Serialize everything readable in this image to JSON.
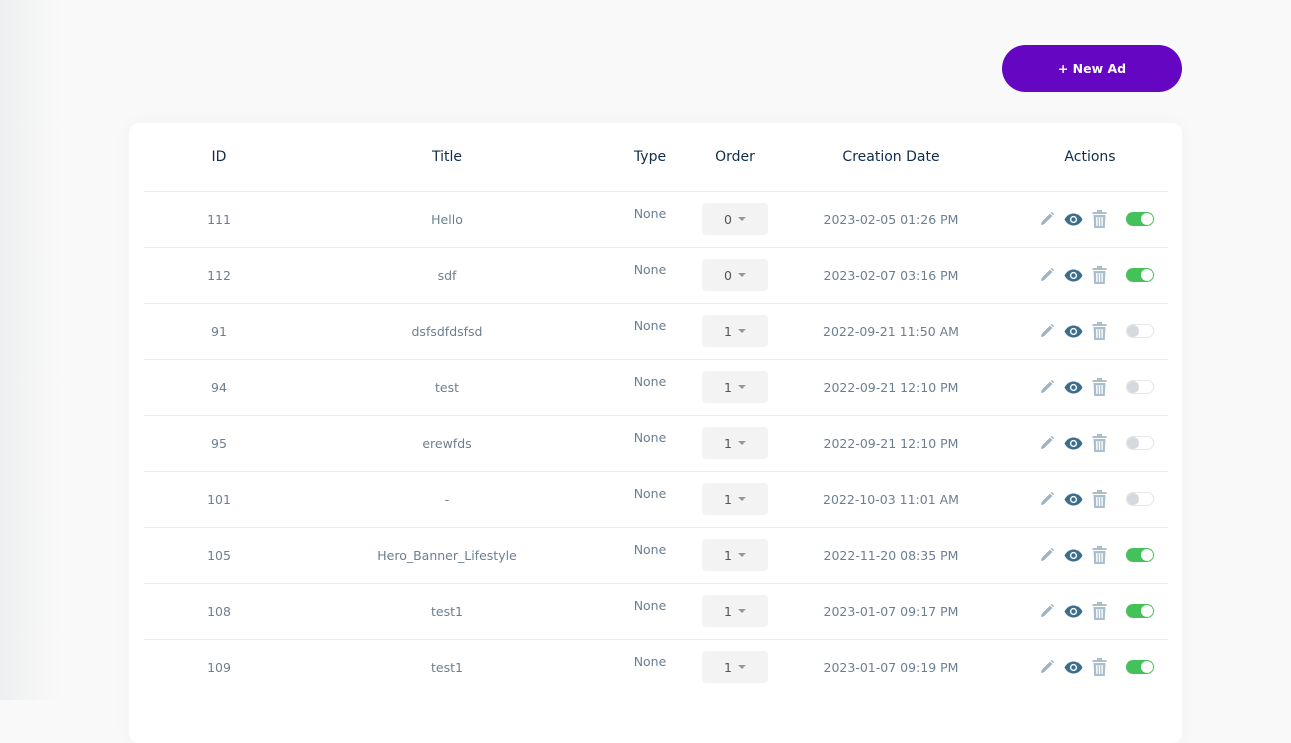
{
  "toolbar": {
    "new_ad_label": "+ New Ad"
  },
  "colors": {
    "accent": "#6506c2",
    "toggle_on": "#45c15a",
    "toggle_off": "#d6dade"
  },
  "table": {
    "headers": {
      "id": "ID",
      "title": "Title",
      "type": "Type",
      "order": "Order",
      "creation_date": "Creation Date",
      "actions": "Actions"
    },
    "rows": [
      {
        "id": "111",
        "title": "Hello",
        "type": "None",
        "order": "0",
        "date": "2023-02-05 01:26 PM",
        "active": true
      },
      {
        "id": "112",
        "title": "sdf",
        "type": "None",
        "order": "0",
        "date": "2023-02-07 03:16 PM",
        "active": true
      },
      {
        "id": "91",
        "title": "dsfsdfdsfsd",
        "type": "None",
        "order": "1",
        "date": "2022-09-21 11:50 AM",
        "active": false
      },
      {
        "id": "94",
        "title": "test",
        "type": "None",
        "order": "1",
        "date": "2022-09-21 12:10 PM",
        "active": false
      },
      {
        "id": "95",
        "title": "erewfds",
        "type": "None",
        "order": "1",
        "date": "2022-09-21 12:10 PM",
        "active": false
      },
      {
        "id": "101",
        "title": "-",
        "type": "None",
        "order": "1",
        "date": "2022-10-03 11:01 AM",
        "active": false
      },
      {
        "id": "105",
        "title": "Hero_Banner_Lifestyle",
        "type": "None",
        "order": "1",
        "date": "2022-11-20 08:35 PM",
        "active": true
      },
      {
        "id": "108",
        "title": "test1",
        "type": "None",
        "order": "1",
        "date": "2023-01-07 09:17 PM",
        "active": true
      },
      {
        "id": "109",
        "title": "test1",
        "type": "None",
        "order": "1",
        "date": "2023-01-07 09:19 PM",
        "active": true
      }
    ],
    "action_icons": [
      "pencil-icon",
      "eye-icon",
      "trash-icon",
      "toggle"
    ]
  }
}
